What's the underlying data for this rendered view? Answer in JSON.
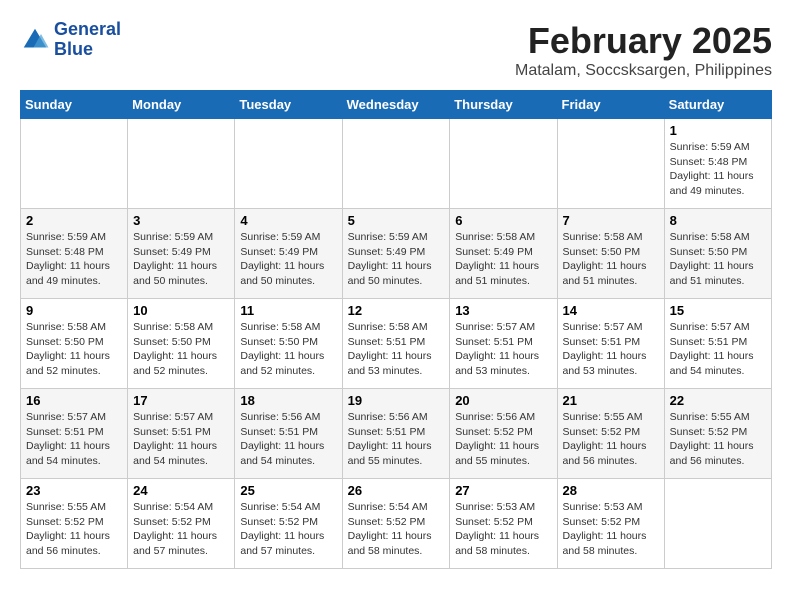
{
  "logo": {
    "line1": "General",
    "line2": "Blue"
  },
  "title": "February 2025",
  "subtitle": "Matalam, Soccsksargen, Philippines",
  "days_of_week": [
    "Sunday",
    "Monday",
    "Tuesday",
    "Wednesday",
    "Thursday",
    "Friday",
    "Saturday"
  ],
  "weeks": [
    [
      {
        "day": "",
        "info": ""
      },
      {
        "day": "",
        "info": ""
      },
      {
        "day": "",
        "info": ""
      },
      {
        "day": "",
        "info": ""
      },
      {
        "day": "",
        "info": ""
      },
      {
        "day": "",
        "info": ""
      },
      {
        "day": "1",
        "info": "Sunrise: 5:59 AM\nSunset: 5:48 PM\nDaylight: 11 hours\nand 49 minutes."
      }
    ],
    [
      {
        "day": "2",
        "info": "Sunrise: 5:59 AM\nSunset: 5:48 PM\nDaylight: 11 hours\nand 49 minutes."
      },
      {
        "day": "3",
        "info": "Sunrise: 5:59 AM\nSunset: 5:49 PM\nDaylight: 11 hours\nand 50 minutes."
      },
      {
        "day": "4",
        "info": "Sunrise: 5:59 AM\nSunset: 5:49 PM\nDaylight: 11 hours\nand 50 minutes."
      },
      {
        "day": "5",
        "info": "Sunrise: 5:59 AM\nSunset: 5:49 PM\nDaylight: 11 hours\nand 50 minutes."
      },
      {
        "day": "6",
        "info": "Sunrise: 5:58 AM\nSunset: 5:49 PM\nDaylight: 11 hours\nand 51 minutes."
      },
      {
        "day": "7",
        "info": "Sunrise: 5:58 AM\nSunset: 5:50 PM\nDaylight: 11 hours\nand 51 minutes."
      },
      {
        "day": "8",
        "info": "Sunrise: 5:58 AM\nSunset: 5:50 PM\nDaylight: 11 hours\nand 51 minutes."
      }
    ],
    [
      {
        "day": "9",
        "info": "Sunrise: 5:58 AM\nSunset: 5:50 PM\nDaylight: 11 hours\nand 52 minutes."
      },
      {
        "day": "10",
        "info": "Sunrise: 5:58 AM\nSunset: 5:50 PM\nDaylight: 11 hours\nand 52 minutes."
      },
      {
        "day": "11",
        "info": "Sunrise: 5:58 AM\nSunset: 5:50 PM\nDaylight: 11 hours\nand 52 minutes."
      },
      {
        "day": "12",
        "info": "Sunrise: 5:58 AM\nSunset: 5:51 PM\nDaylight: 11 hours\nand 53 minutes."
      },
      {
        "day": "13",
        "info": "Sunrise: 5:57 AM\nSunset: 5:51 PM\nDaylight: 11 hours\nand 53 minutes."
      },
      {
        "day": "14",
        "info": "Sunrise: 5:57 AM\nSunset: 5:51 PM\nDaylight: 11 hours\nand 53 minutes."
      },
      {
        "day": "15",
        "info": "Sunrise: 5:57 AM\nSunset: 5:51 PM\nDaylight: 11 hours\nand 54 minutes."
      }
    ],
    [
      {
        "day": "16",
        "info": "Sunrise: 5:57 AM\nSunset: 5:51 PM\nDaylight: 11 hours\nand 54 minutes."
      },
      {
        "day": "17",
        "info": "Sunrise: 5:57 AM\nSunset: 5:51 PM\nDaylight: 11 hours\nand 54 minutes."
      },
      {
        "day": "18",
        "info": "Sunrise: 5:56 AM\nSunset: 5:51 PM\nDaylight: 11 hours\nand 54 minutes."
      },
      {
        "day": "19",
        "info": "Sunrise: 5:56 AM\nSunset: 5:51 PM\nDaylight: 11 hours\nand 55 minutes."
      },
      {
        "day": "20",
        "info": "Sunrise: 5:56 AM\nSunset: 5:52 PM\nDaylight: 11 hours\nand 55 minutes."
      },
      {
        "day": "21",
        "info": "Sunrise: 5:55 AM\nSunset: 5:52 PM\nDaylight: 11 hours\nand 56 minutes."
      },
      {
        "day": "22",
        "info": "Sunrise: 5:55 AM\nSunset: 5:52 PM\nDaylight: 11 hours\nand 56 minutes."
      }
    ],
    [
      {
        "day": "23",
        "info": "Sunrise: 5:55 AM\nSunset: 5:52 PM\nDaylight: 11 hours\nand 56 minutes."
      },
      {
        "day": "24",
        "info": "Sunrise: 5:54 AM\nSunset: 5:52 PM\nDaylight: 11 hours\nand 57 minutes."
      },
      {
        "day": "25",
        "info": "Sunrise: 5:54 AM\nSunset: 5:52 PM\nDaylight: 11 hours\nand 57 minutes."
      },
      {
        "day": "26",
        "info": "Sunrise: 5:54 AM\nSunset: 5:52 PM\nDaylight: 11 hours\nand 58 minutes."
      },
      {
        "day": "27",
        "info": "Sunrise: 5:53 AM\nSunset: 5:52 PM\nDaylight: 11 hours\nand 58 minutes."
      },
      {
        "day": "28",
        "info": "Sunrise: 5:53 AM\nSunset: 5:52 PM\nDaylight: 11 hours\nand 58 minutes."
      },
      {
        "day": "",
        "info": ""
      }
    ]
  ]
}
